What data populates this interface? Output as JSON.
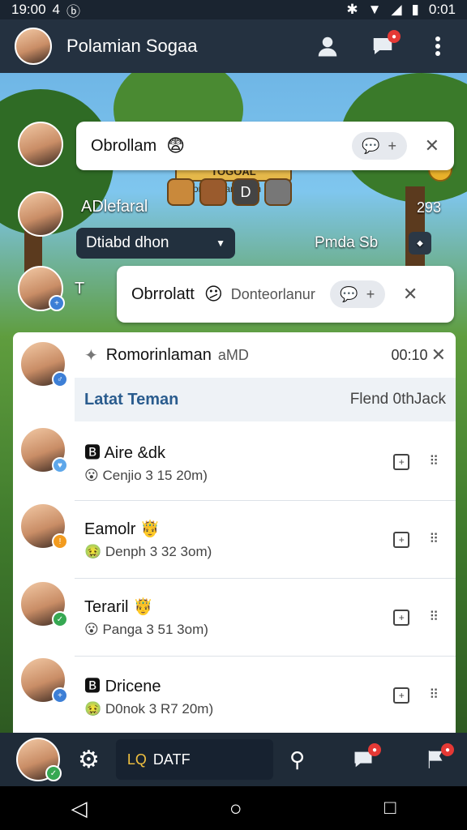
{
  "status_bar": {
    "time": "19:00",
    "left_icons": "4",
    "battery": "0:01"
  },
  "app_bar": {
    "title": "Polamian Sogaa"
  },
  "game": {
    "banner": "TOGOAL",
    "banner_sub": "Ponion dan Sbnn",
    "player_name": "ADlefaral",
    "score": "293",
    "dropdown_left": "Dtiabd dhon",
    "dropdown_right": "Pmda Sb",
    "char_box": "D"
  },
  "bubble1": {
    "text": "Obrollam",
    "emoji": "😨"
  },
  "bubble2": {
    "prefix": "T",
    "text": "Obrrolatt",
    "emoji": "😕",
    "sub": "Donteorlanur"
  },
  "panel": {
    "title": "Romorinlaman",
    "meta": "aMD",
    "time": "00:10",
    "friends_title": "Latat Teman",
    "friends_right": "Flend 0thJack",
    "friends": [
      {
        "name": "Aire &dk",
        "status": "Cenjio 3 15 20m)",
        "name_emoji": "🅱",
        "status_emoji": "😮"
      },
      {
        "name": "Eamolr",
        "status": "Denph 3 32 3om)",
        "name_emoji": "🤴",
        "status_emoji": "🤢"
      },
      {
        "name": "Teraril",
        "status": "Panga 3 51 3om)",
        "name_emoji": "🤴",
        "status_emoji": "😮"
      },
      {
        "name": "Dricene",
        "status": "D0nok 3 R7 20m)",
        "name_emoji": "🅱",
        "status_emoji": "🤢"
      }
    ]
  },
  "bottom_bar": {
    "tab_label": "DATF",
    "tab_prefix": "LQ"
  },
  "colors": {
    "appbar": "#243140",
    "accent_blue": "#2a5c8e",
    "badge_red": "#e53935"
  }
}
